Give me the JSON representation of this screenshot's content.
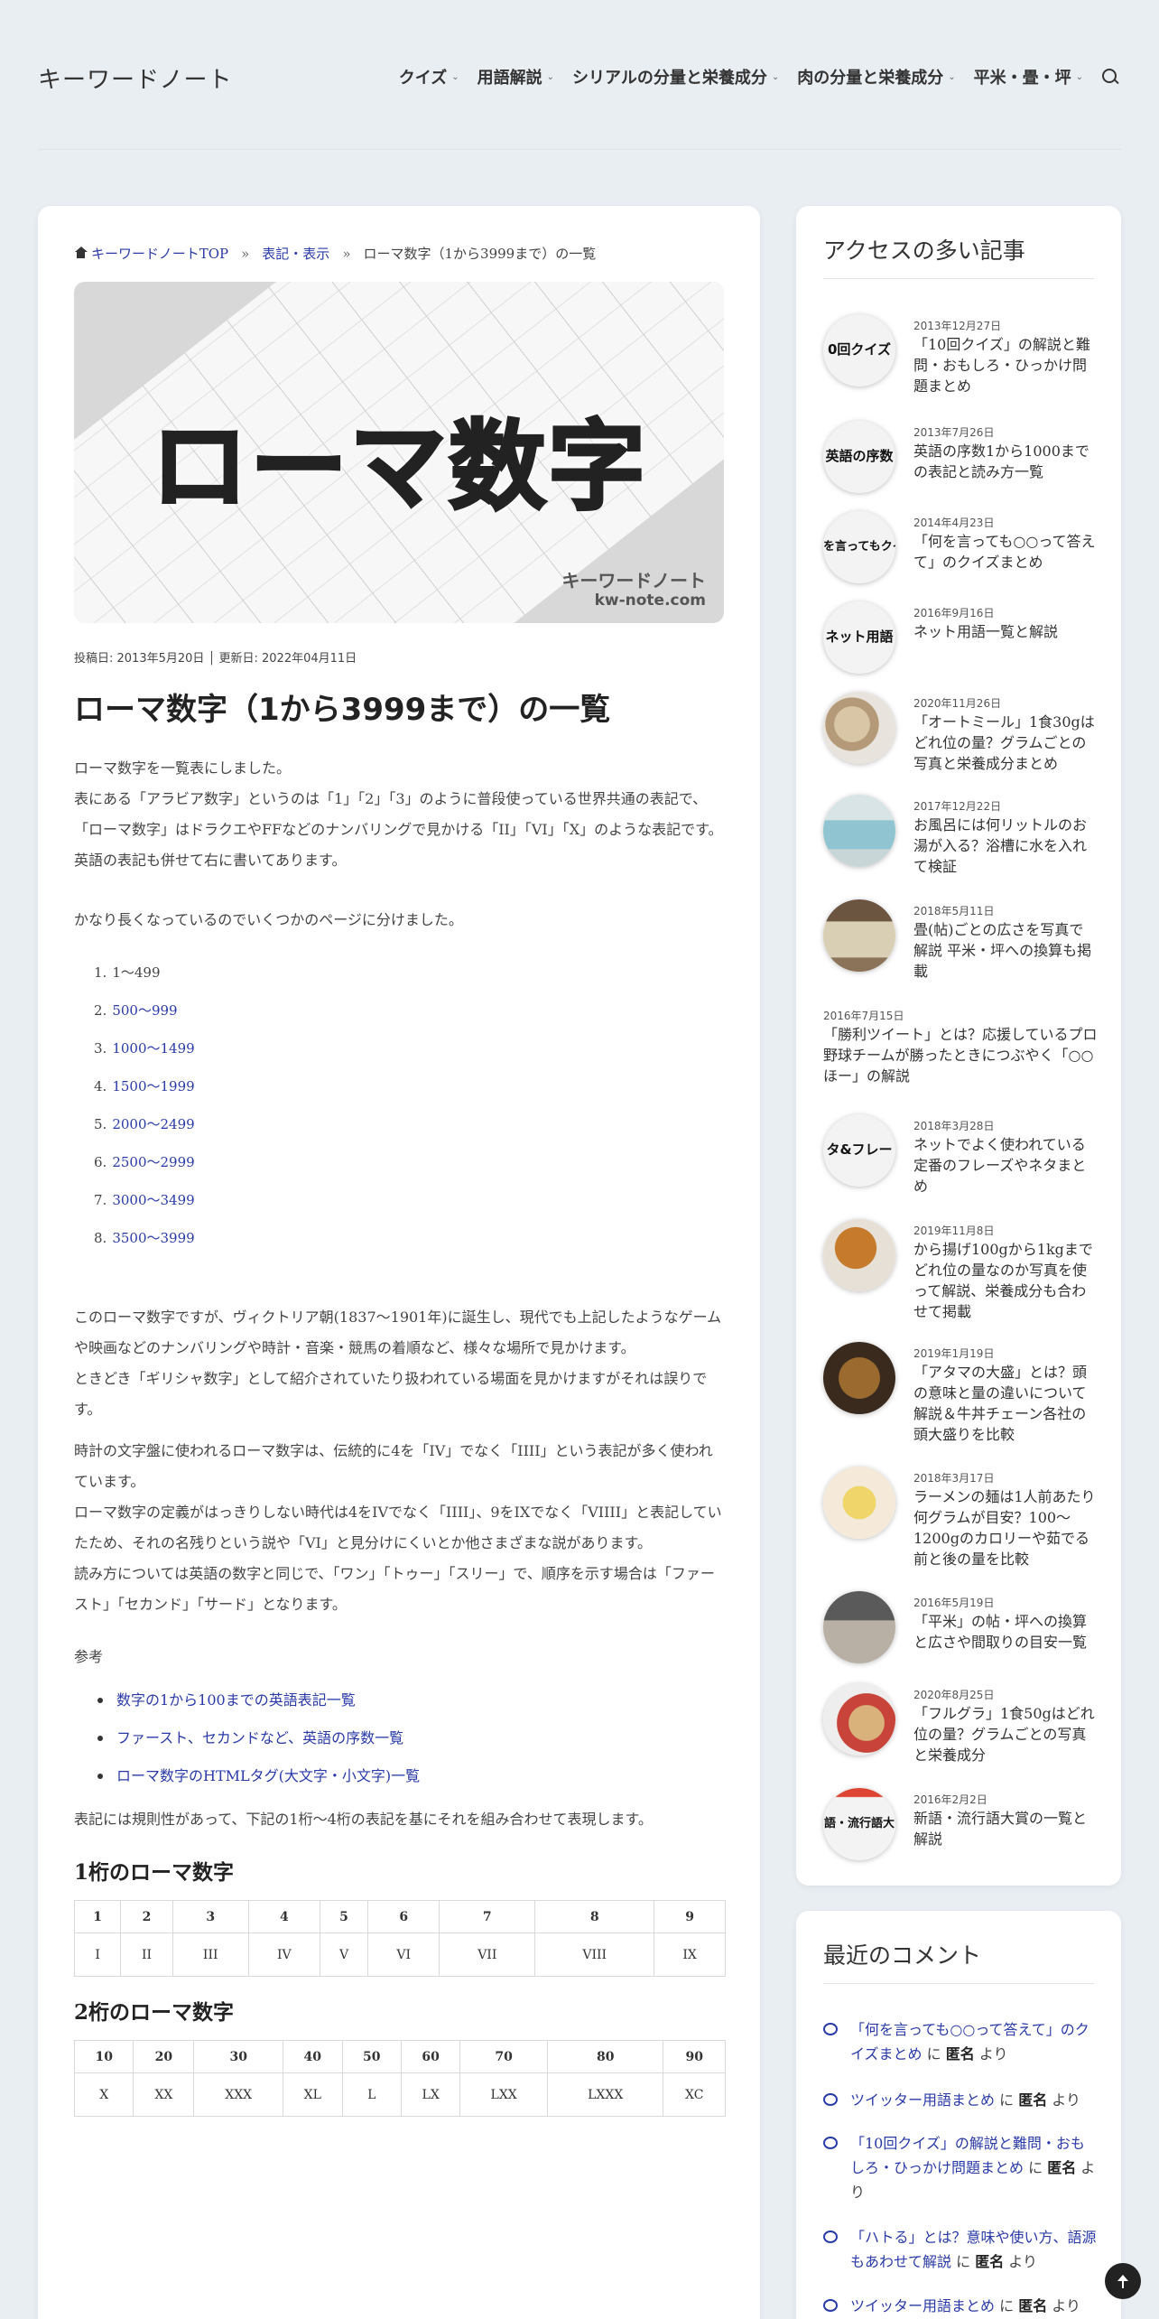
{
  "header": {
    "logo": "キーワードノート",
    "nav": [
      "クイズ",
      "用語解説",
      "シリアルの分量と栄養成分",
      "肉の分量と栄養成分",
      "平米・畳・坪"
    ]
  },
  "breadcrumb": [
    "キーワードノートTOP",
    "表記・表示",
    "ローマ数字（1から3999まで）の一覧"
  ],
  "hero": {
    "big": "ローマ数字",
    "site_name": "キーワードノート",
    "site_domain": "kw-note.com"
  },
  "meta": "投稿日:  2013年5月20日 │ 更新日:  2022年04月11日",
  "title": "ローマ数字（1から3999まで）の一覧",
  "intro": [
    "ローマ数字を一覧表にしました。",
    "表にある「アラビア数字」というのは「1」「2」「3」のように普段使っている世界共通の表記で、「ローマ数字」はドラクエやFFなどのナンバリングで見かける「II」「VI」「X」のような表記です。",
    "英語の表記も併せて右に書いてあります。"
  ],
  "split_note": "かなり長くなっているのでいくつかのページに分けました。",
  "pages": [
    "1～499",
    "500～999",
    "1000～1499",
    "1500～1999",
    "2000～2499",
    "2500～2999",
    "3000～3499",
    "3500～3999"
  ],
  "history": [
    "このローマ数字ですが、ヴィクトリア朝(1837～1901年)に誕生し、現代でも上記したようなゲームや映画などのナンバリングや時計・音楽・競馬の着順など、様々な場所で見かけます。",
    "ときどき「ギリシャ数字」として紹介されていたり扱われている場面を見かけますがそれは誤りです。"
  ],
  "clock": [
    "時計の文字盤に使われるローマ数字は、伝統的に4を「IV」でなく「IIII」という表記が多く使われています。",
    "ローマ数字の定義がはっきりしない時代は4をIVでなく「IIII」、9をIXでなく「VIIII」と表記していたため、それの名残りという説や「VI」と見分けにくいとか他さまざまな説があります。",
    "読み方については英語の数字と同じで、「ワン」「トゥー」「スリー」で、順序を示す場合は「ファースト」「セカンド」「サード」となります。"
  ],
  "ref_label": "参考",
  "refs": [
    "数字の1から100までの英語表記一覧",
    "ファースト、セカンドなど、英語の序数一覧",
    "ローマ数字のHTMLタグ(大文字・小文字)一覧"
  ],
  "rule_note": "表記には規則性があって、下記の1桁～4桁の表記を基にそれを組み合わせて表現します。",
  "table1": {
    "heading": "1桁のローマ数字",
    "head": [
      "1",
      "2",
      "3",
      "4",
      "5",
      "6",
      "7",
      "8",
      "9"
    ],
    "row": [
      "I",
      "II",
      "III",
      "IV",
      "V",
      "VI",
      "VII",
      "VIII",
      "IX"
    ]
  },
  "table2": {
    "heading": "2桁のローマ数字",
    "head": [
      "10",
      "20",
      "30",
      "40",
      "50",
      "60",
      "70",
      "80",
      "90"
    ],
    "row": [
      "X",
      "XX",
      "XXX",
      "XL",
      "L",
      "LX",
      "LXX",
      "LXXX",
      "XC"
    ]
  },
  "sidebar": {
    "popular_title": "アクセスの多い記事",
    "popular": [
      {
        "thumb": "0回クイズ",
        "date": "2013年12月27日",
        "title": "「10回クイズ」の解説と難問・おもしろ・ひっかけ問題まとめ"
      },
      {
        "thumb": "英語の序数",
        "date": "2013年7月26日",
        "title": "英語の序数1から1000までの表記と読み方一覧"
      },
      {
        "thumb": "を言ってもクイ",
        "date": "2014年4月23日",
        "title": "「何を言っても○○って答えて」のクイズまとめ"
      },
      {
        "thumb": "ネット用語",
        "date": "2016年9月16日",
        "title": "ネット用語一覧と解説"
      },
      {
        "thumb": "",
        "date": "2020年11月26日",
        "title": "「オートミール」1食30gはどれ位の量？グラムごとの写真と栄養成分まとめ"
      },
      {
        "thumb": "",
        "date": "2017年12月22日",
        "title": "お風呂には何リットルのお湯が入る？浴槽に水を入れて検証"
      },
      {
        "thumb": "",
        "date": "2018年5月11日",
        "title": "畳(帖)ごとの広さを写真で解説 平米・坪への換算も掲載"
      },
      {
        "thumb": "",
        "date": "2016年7月15日",
        "title": "「勝利ツイート」とは？応援しているプロ野球チームが勝ったときにつぶやく「○○ほー」の解説"
      },
      {
        "thumb": "タ&フレー",
        "date": "2018年3月28日",
        "title": "ネットでよく使われている定番のフレーズやネタまとめ"
      },
      {
        "thumb": "",
        "date": "2019年11月8日",
        "title": "から揚げ100gから1kgまでどれ位の量なのか写真を使って解説、栄養成分も合わせて掲載"
      },
      {
        "thumb": "",
        "date": "2019年1月19日",
        "title": "「アタマの大盛」とは？頭の意味と量の違いについて解説＆牛丼チェーン各社の頭大盛りを比較"
      },
      {
        "thumb": "",
        "date": "2018年3月17日",
        "title": "ラーメンの麺は1人前あたり何グラムが目安？100～1200gのカロリーや茹でる前と後の量を比較"
      },
      {
        "thumb": "",
        "date": "2016年5月19日",
        "title": "「平米」の帖・坪への換算と広さや間取りの目安一覧"
      },
      {
        "thumb": "",
        "date": "2020年8月25日",
        "title": "「フルグラ」1食50gはどれ位の量？グラムごとの写真と栄養成分"
      },
      {
        "thumb": "語・流行語大",
        "date": "2016年2月2日",
        "title": "新語・流行語大賞の一覧と解説"
      }
    ],
    "comments_title": "最近のコメント",
    "comments": [
      {
        "post": "「何を言っても○○って答えて」のクイズまとめ",
        "mid": " に ",
        "user": "匿名",
        "tail": " より"
      },
      {
        "post": "ツイッター用語まとめ",
        "mid": " に ",
        "user": "匿名",
        "tail": " より"
      },
      {
        "post": "「10回クイズ」の解説と難問・おもしろ・ひっかけ問題まとめ",
        "mid": " に ",
        "user": "匿名",
        "tail": " より"
      },
      {
        "post": "「ハトる」とは？意味や使い方、語源もあわせて解説",
        "mid": " に ",
        "user": "匿名",
        "tail": " より"
      },
      {
        "post": "ツイッター用語まとめ",
        "mid": " に ",
        "user": "匿名",
        "tail": " より"
      }
    ]
  }
}
